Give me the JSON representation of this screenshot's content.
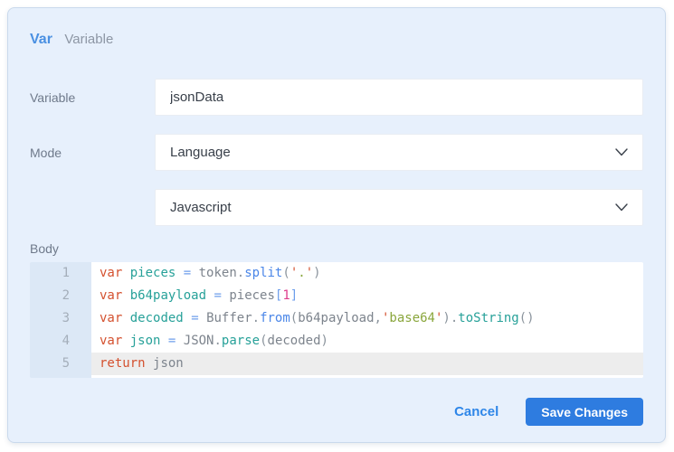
{
  "header": {
    "badge": "Var",
    "subtitle": "Variable"
  },
  "form": {
    "variable": {
      "label": "Variable",
      "value": "jsonData"
    },
    "mode": {
      "label": "Mode",
      "value": "Language"
    },
    "language": {
      "value": "Javascript"
    },
    "body": {
      "label": "Body"
    }
  },
  "editor": {
    "lines": [
      {
        "n": "1",
        "highlight": false,
        "tokens": [
          [
            "kw",
            "var"
          ],
          [
            "sp",
            " "
          ],
          [
            "def",
            "pieces"
          ],
          [
            "sp",
            " "
          ],
          [
            "op",
            "="
          ],
          [
            "sp",
            " "
          ],
          [
            "id",
            "token"
          ],
          [
            "pun",
            "."
          ],
          [
            "mb",
            "split"
          ],
          [
            "pun",
            "("
          ],
          [
            "sq",
            "'"
          ],
          [
            "st",
            "."
          ],
          [
            "sq",
            "'"
          ],
          [
            "pun",
            ")"
          ]
        ]
      },
      {
        "n": "2",
        "highlight": false,
        "tokens": [
          [
            "kw",
            "var"
          ],
          [
            "sp",
            " "
          ],
          [
            "def",
            "b64payload"
          ],
          [
            "sp",
            " "
          ],
          [
            "op",
            "="
          ],
          [
            "sp",
            " "
          ],
          [
            "id",
            "pieces"
          ],
          [
            "br",
            "["
          ],
          [
            "num",
            "1"
          ],
          [
            "br",
            "]"
          ]
        ]
      },
      {
        "n": "3",
        "highlight": false,
        "tokens": [
          [
            "kw",
            "var"
          ],
          [
            "sp",
            " "
          ],
          [
            "def",
            "decoded"
          ],
          [
            "sp",
            " "
          ],
          [
            "op",
            "="
          ],
          [
            "sp",
            " "
          ],
          [
            "id",
            "Buffer"
          ],
          [
            "pun",
            "."
          ],
          [
            "mb",
            "from"
          ],
          [
            "pun",
            "("
          ],
          [
            "id",
            "b64payload"
          ],
          [
            "pun",
            ","
          ],
          [
            "sq",
            "'"
          ],
          [
            "st",
            "base64"
          ],
          [
            "sq",
            "'"
          ],
          [
            "pun",
            ")"
          ],
          [
            "pun",
            "."
          ],
          [
            "mt",
            "toString"
          ],
          [
            "pun",
            "()"
          ]
        ]
      },
      {
        "n": "4",
        "highlight": false,
        "tokens": [
          [
            "kw",
            "var"
          ],
          [
            "sp",
            " "
          ],
          [
            "def",
            "json"
          ],
          [
            "sp",
            " "
          ],
          [
            "op",
            "="
          ],
          [
            "sp",
            " "
          ],
          [
            "id",
            "JSON"
          ],
          [
            "pun",
            "."
          ],
          [
            "mt",
            "parse"
          ],
          [
            "pun",
            "("
          ],
          [
            "id",
            "decoded"
          ],
          [
            "pun",
            ")"
          ]
        ]
      },
      {
        "n": "5",
        "highlight": true,
        "tokens": [
          [
            "kw",
            "return"
          ],
          [
            "sp",
            " "
          ],
          [
            "id",
            "json"
          ]
        ]
      }
    ]
  },
  "footer": {
    "cancel": "Cancel",
    "save": "Save Changes"
  },
  "icons": {
    "dropdown": "chevron-down"
  },
  "colors": {
    "accent": "#4a90e2",
    "dialog_bg": "#e7f0fc",
    "dialog_border": "#c9d9ec",
    "save_button_bg": "#2e7ce0",
    "cancel_link": "#2e86e8",
    "label_text": "#6f7a8b",
    "input_text": "#39404a",
    "gutter_bg": "#dce8f6",
    "line_number": "#a4aeba",
    "highlight_row": "#ededed",
    "token_keyword": "#d4512f",
    "token_definition": "#27a199",
    "token_operator": "#6d9eeb",
    "token_identifier": "#7d848d",
    "token_punctuation": "#8b949d",
    "token_method_blue": "#4a86e8",
    "token_method_teal": "#27a199",
    "token_string_quote": "#d4512f",
    "token_string": "#8aa63c",
    "token_number": "#df3e8c",
    "token_bracket": "#6d9eeb"
  }
}
